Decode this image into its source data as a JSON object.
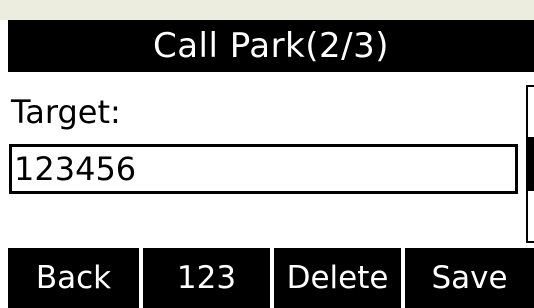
{
  "screen": {
    "title": "Call Park(2/3)"
  },
  "field": {
    "label": "Target:",
    "value": "123456"
  },
  "scroll": {
    "page": 2,
    "total": 3
  },
  "softkeys": [
    {
      "label": "Back"
    },
    {
      "label": "123"
    },
    {
      "label": "Delete"
    },
    {
      "label": "Save"
    }
  ],
  "colors": {
    "background": "#ffffff",
    "bar": "#000000",
    "bezel": "#ececdf",
    "text_inverse": "#ffffff"
  }
}
